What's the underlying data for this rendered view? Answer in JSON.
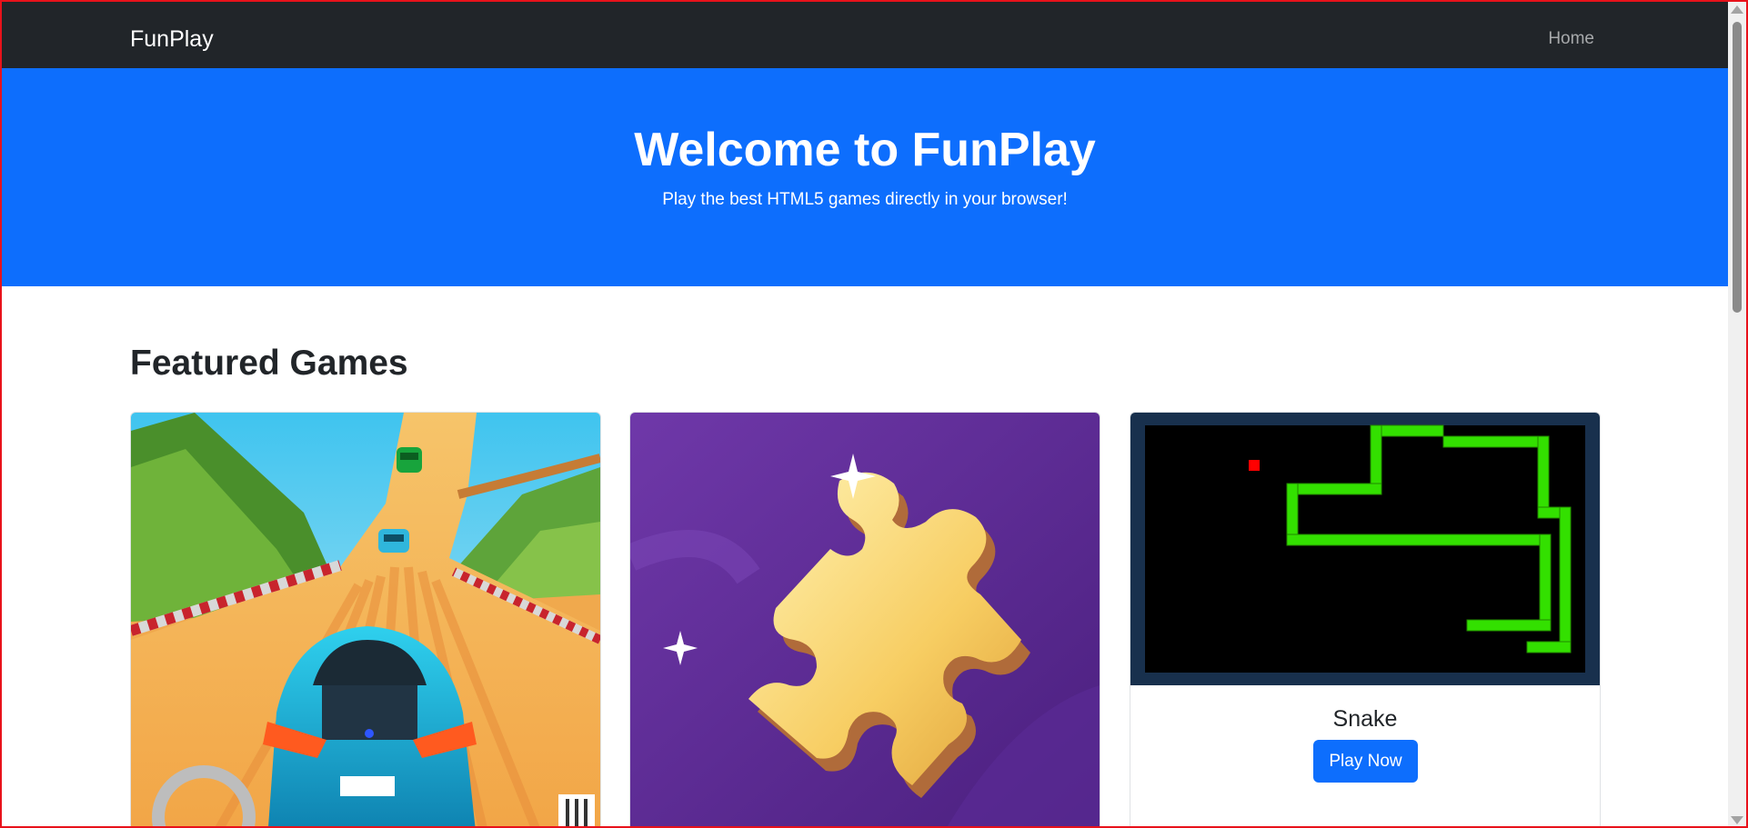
{
  "navbar": {
    "brand": "FunPlay",
    "home_link": "Home"
  },
  "hero": {
    "title": "Welcome to FunPlay",
    "subtitle": "Play the best HTML5 games directly in your browser!",
    "background_color": "#0d6efd"
  },
  "featured": {
    "heading": "Featured Games",
    "games": [
      {
        "thumbnail": "racing-game-thumbnail"
      },
      {
        "thumbnail": "jigsaw-puzzle-thumbnail"
      },
      {
        "thumbnail": "snake-game-thumbnail",
        "title": "Snake",
        "button_label": "Play Now"
      }
    ]
  },
  "colors": {
    "navbar": "#212529",
    "primary": "#0d6efd",
    "text": "#212529"
  }
}
